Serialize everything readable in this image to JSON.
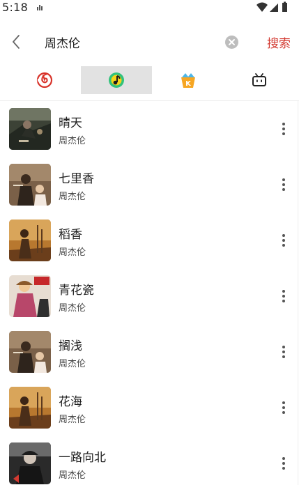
{
  "status_bar": {
    "time": "5:18",
    "icons": [
      "notification-icon",
      "wifi-icon",
      "signal-icon",
      "battery-icon"
    ]
  },
  "search": {
    "back_icon": "chevron-left-icon",
    "query": "周杰伦",
    "clear_icon": "clear-circle-icon",
    "submit_label": "搜索"
  },
  "sources": {
    "active_index": 1,
    "tabs": [
      {
        "icon": "netease-music-icon",
        "color": "#d8332a"
      },
      {
        "icon": "qq-music-icon",
        "color": "#31c27c"
      },
      {
        "icon": "kuwo-music-icon",
        "color": "#f6a623"
      },
      {
        "icon": "bilibili-tv-icon",
        "color": "#222222"
      }
    ]
  },
  "songs": [
    {
      "title": "晴天",
      "artist": "周杰伦"
    },
    {
      "title": "七里香",
      "artist": "周杰伦"
    },
    {
      "title": "稻香",
      "artist": "周杰伦"
    },
    {
      "title": "青花瓷",
      "artist": "周杰伦"
    },
    {
      "title": "搁浅",
      "artist": "周杰伦"
    },
    {
      "title": "花海",
      "artist": "周杰伦"
    },
    {
      "title": "一路向北",
      "artist": "周杰伦"
    }
  ],
  "colors": {
    "accent": "#d33a31",
    "active_tab_bg": "#e2e2e2"
  }
}
